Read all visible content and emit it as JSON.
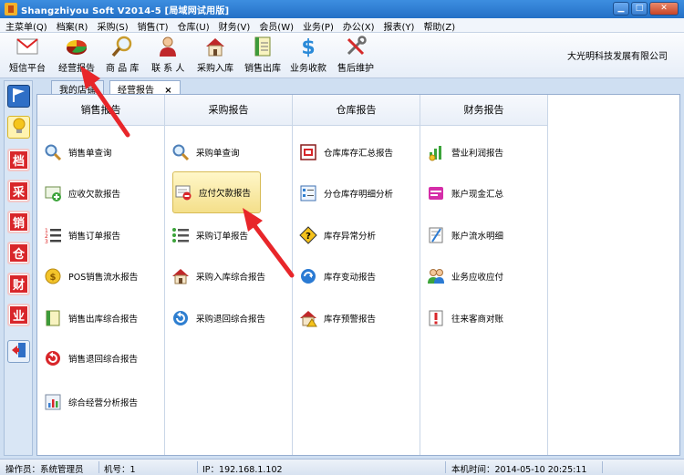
{
  "window": {
    "title": "Shangzhiyou Soft V2014-5 [局域网试用版]"
  },
  "menu": [
    "主菜单(Q)",
    "档案(R)",
    "采购(S)",
    "销售(T)",
    "仓库(U)",
    "财务(V)",
    "会员(W)",
    "业务(P)",
    "办公(X)",
    "报表(Y)",
    "帮助(Z)"
  ],
  "toolbar": {
    "buttons": [
      "短信平台",
      "经营报告",
      "商 品 库",
      "联 系 人",
      "采购入库",
      "销售出库",
      "业务收款",
      "售后维护"
    ],
    "company": "大光明科技发展有限公司"
  },
  "tabs": {
    "home": "我的店铺",
    "report": "经营报告",
    "close": "×"
  },
  "columns": [
    {
      "title": "销售报告",
      "items": [
        "销售单查询",
        "应收欠款报告",
        "销售订单报告",
        "POS销售流水报告",
        "销售出库综合报告",
        "销售退回综合报告",
        "综合经营分析报告"
      ]
    },
    {
      "title": "采购报告",
      "items": [
        "采购单查询",
        "应付欠款报告",
        "采购订单报告",
        "采购入库综合报告",
        "采购退回综合报告"
      ]
    },
    {
      "title": "仓库报告",
      "items": [
        "仓库库存汇总报告",
        "分仓库存明细分析",
        "库存异常分析",
        "库存变动报告",
        "库存预警报告"
      ]
    },
    {
      "title": "财务报告",
      "items": [
        "营业利润报告",
        "账户现金汇总",
        "账户流水明细",
        "业务应收应付",
        "往来客商对账"
      ]
    }
  ],
  "leftnav": [
    "档",
    "采",
    "销",
    "仓",
    "财",
    "业"
  ],
  "status": {
    "operator": "操作员：系统管理员",
    "machine": "机号：1",
    "ip": "IP：192.168.1.102",
    "time": "本机时间：2014-05-10 20:25:11"
  },
  "colors": {
    "accent": "#2a7ad3",
    "arrow": "#e8262a",
    "highlight": "#f4df8a"
  }
}
